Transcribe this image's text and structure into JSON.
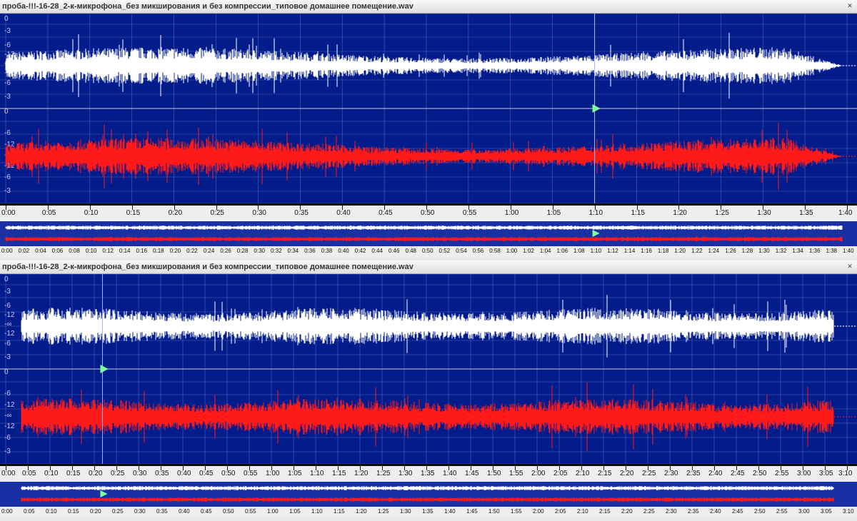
{
  "panels": [
    {
      "title": "проба-!!!-16-28_2-к-микрофона_без микширования и без компрессии_типовое домашнее помещение.wav",
      "db_labels": [
        "0",
        "-3",
        "-6",
        "-12",
        "-∞",
        "-12",
        "-6",
        "-3",
        "0",
        "-6",
        "-12",
        "-∞",
        "-12",
        "-6",
        "-3"
      ],
      "ruler_ticks": [
        "0:00",
        "0:05",
        "0:10",
        "0:15",
        "0:20",
        "0:25",
        "0:30",
        "0:35",
        "0:40",
        "0:45",
        "0:50",
        "0:55",
        "1:00",
        "1:05",
        "1:10",
        "1:15",
        "1:20",
        "1:25",
        "1:30",
        "1:35",
        "1:40"
      ],
      "mini_ticks": [
        "0:00",
        "0:02",
        "0:04",
        "0:06",
        "0:08",
        "0:10",
        "0:12",
        "0:14",
        "0:16",
        "0:18",
        "0:20",
        "0:22",
        "0:24",
        "0:26",
        "0:28",
        "0:30",
        "0:32",
        "0:34",
        "0:36",
        "0:38",
        "0:40",
        "0:42",
        "0:44",
        "0:46",
        "0:48",
        "0:50",
        "0:52",
        "0:54",
        "0:56",
        "0:58",
        "1:00",
        "1:02",
        "1:04",
        "1:06",
        "1:08",
        "1:10",
        "1:12",
        "1:14",
        "1:16",
        "1:18",
        "1:20",
        "1:22",
        "1:24",
        "1:26",
        "1:28",
        "1:30",
        "1:32",
        "1:34",
        "1:36",
        "1:38",
        "1:40"
      ],
      "playhead_position": 0.7
    },
    {
      "title": "проба-!!!-16-28_2-к-микрофона_без микширования и без компрессии_типовое домашнее помещение.wav",
      "db_labels": [
        "0",
        "-3",
        "-6",
        "-12",
        "-∞",
        "-12",
        "-6",
        "-3",
        "0",
        "-6",
        "-12",
        "-∞",
        "-12",
        "-6",
        "-3"
      ],
      "ruler_ticks": [
        "0:00",
        "0:05",
        "0:10",
        "0:15",
        "0:20",
        "0:25",
        "0:30",
        "0:35",
        "0:40",
        "0:45",
        "0:50",
        "0:55",
        "1:00",
        "1:05",
        "1:10",
        "1:15",
        "1:20",
        "1:25",
        "1:30",
        "1:35",
        "1:40",
        "1:45",
        "1:50",
        "1:55",
        "2:00",
        "2:05",
        "2:10",
        "2:15",
        "2:20",
        "2:25",
        "2:30",
        "2:35",
        "2:40",
        "2:45",
        "2:50",
        "2:55",
        "3:00",
        "3:05",
        "3:10"
      ],
      "mini_ticks": [
        "0:00",
        "0:05",
        "0:10",
        "0:15",
        "0:20",
        "0:25",
        "0:30",
        "0:35",
        "0:40",
        "0:45",
        "0:50",
        "0:55",
        "1:00",
        "1:05",
        "1:10",
        "1:15",
        "1:20",
        "1:25",
        "1:30",
        "1:35",
        "1:40",
        "1:45",
        "1:50",
        "1:55",
        "2:00",
        "2:05",
        "2:10",
        "2:15",
        "2:20",
        "2:25",
        "2:30",
        "2:35",
        "2:40",
        "2:45",
        "2:50",
        "2:55",
        "3:00",
        "3:05",
        "3:10"
      ],
      "playhead_position": 0.115
    }
  ],
  "colors": {
    "background": "#031c8c",
    "left_channel": "#ffffff",
    "right_channel": "#ff1a1a",
    "grid": "#6f7fc8",
    "playhead_marker": "#7dff9a"
  },
  "window_buttons": [
    "minimize",
    "maximize",
    "close"
  ]
}
